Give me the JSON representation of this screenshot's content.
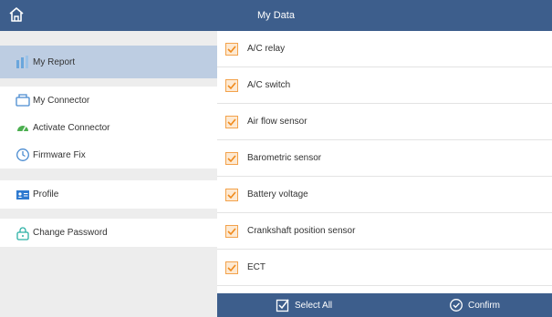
{
  "header": {
    "title": "My Data"
  },
  "sidebar": {
    "items": [
      {
        "label": "My Report"
      },
      {
        "label": "My Connector"
      },
      {
        "label": "Activate Connector"
      },
      {
        "label": "Firmware Fix"
      },
      {
        "label": "Profile"
      },
      {
        "label": "Change Password"
      }
    ]
  },
  "list": {
    "items": [
      {
        "label": "A/C relay",
        "checked": true
      },
      {
        "label": "A/C switch",
        "checked": true
      },
      {
        "label": "Air flow sensor",
        "checked": true
      },
      {
        "label": "Barometric sensor",
        "checked": true
      },
      {
        "label": "Battery voltage",
        "checked": true
      },
      {
        "label": "Crankshaft position sensor",
        "checked": true
      },
      {
        "label": "ECT",
        "checked": true
      }
    ]
  },
  "footer": {
    "select_all": "Select All",
    "confirm": "Confirm"
  },
  "colors": {
    "header": "#3d5e8c",
    "active_item": "#bdcde2",
    "checkbox": "#f3a24b"
  }
}
